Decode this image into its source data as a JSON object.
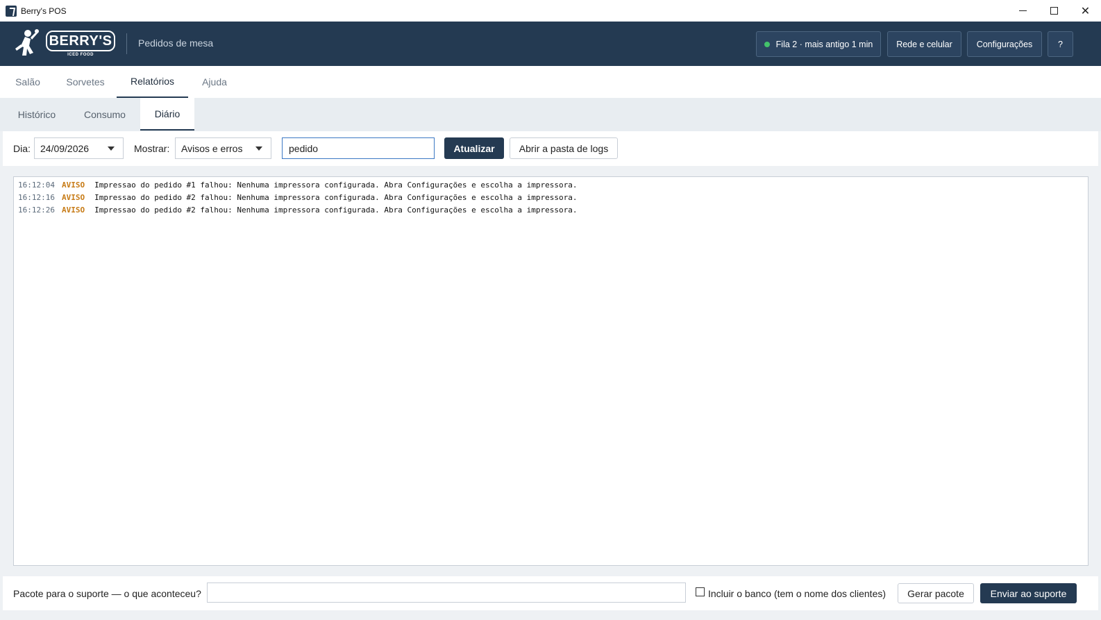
{
  "window": {
    "title": "Berry's POS"
  },
  "header": {
    "logo_text": "BERRY'S",
    "logo_sub": "ICED FOOD",
    "subtitle": "Pedidos de mesa",
    "queue_status": "Fila 2 · mais antigo 1 min",
    "network_button": "Rede e celular",
    "settings_button": "Configurações",
    "help_button": "?"
  },
  "main_tabs": [
    {
      "label": "Salão"
    },
    {
      "label": "Sorvetes"
    },
    {
      "label": "Relatórios"
    },
    {
      "label": "Ajuda"
    }
  ],
  "sub_tabs": [
    {
      "label": "Histórico"
    },
    {
      "label": "Consumo"
    },
    {
      "label": "Diário"
    }
  ],
  "filters": {
    "day_label": "Dia:",
    "day_value": "24/09/2026",
    "show_label": "Mostrar:",
    "show_value": "Avisos e erros",
    "search_value": "pedido",
    "refresh_button": "Atualizar",
    "open_logs_button": "Abrir a pasta de logs"
  },
  "log_entries": [
    {
      "time": "16:12:04",
      "level": "AVISO",
      "message": "Impressao do pedido #1 falhou: Nenhuma impressora configurada. Abra Configurações e escolha a impressora."
    },
    {
      "time": "16:12:16",
      "level": "AVISO",
      "message": "Impressao do pedido #2 falhou: Nenhuma impressora configurada. Abra Configurações e escolha a impressora."
    },
    {
      "time": "16:12:26",
      "level": "AVISO",
      "message": "Impressao do pedido #2 falhou: Nenhuma impressora configurada. Abra Configurações e escolha a impressora."
    }
  ],
  "footer": {
    "support_label": "Pacote para o suporte — o que aconteceu?",
    "support_input_value": "",
    "include_db_label": "Incluir o banco (tem o nome dos clientes)",
    "generate_button": "Gerar pacote",
    "send_button": "Enviar ao suporte"
  },
  "colors": {
    "header_bg": "#243a52",
    "accent": "#243a52",
    "status_ok": "#43c36b",
    "warning_level": "#c77b16"
  }
}
